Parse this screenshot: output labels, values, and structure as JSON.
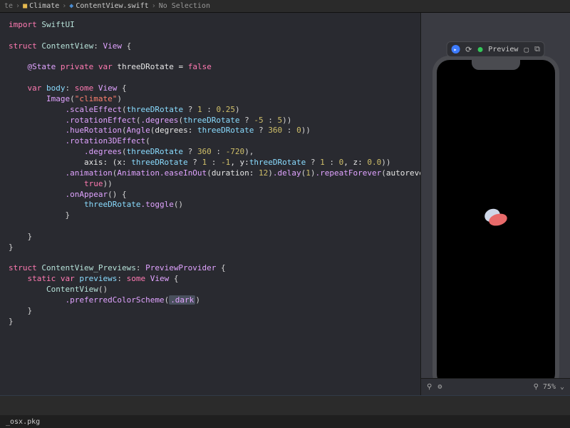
{
  "breadcrumb": {
    "project": "Climate",
    "file": "ContentView.swift",
    "selection": "No Selection"
  },
  "preview": {
    "label": "Preview",
    "zoom": "75%"
  },
  "download": {
    "filename": "_osx.pkg"
  },
  "code": {
    "import_kw": "import",
    "swiftui": "SwiftUI",
    "struct_kw": "struct",
    "contentview": "ContentView",
    "view": "View",
    "state": "@State",
    "private": "private",
    "var_kw": "var",
    "threeDRotate": "threeDRotate",
    "eq_false": " = ",
    "false_lit": "false",
    "body": "body",
    "some": "some",
    "image": "Image",
    "climate_str": "\"climate\"",
    "scaleEffect": ".scaleEffect",
    "rotationEffect": ".rotationEffect",
    "degrees": ".degrees",
    "hueRotation": ".hueRotation",
    "angle": "Angle",
    "degrees_lbl": "degrees:",
    "rotation3DEffect": ".rotation3DEffect",
    "axis_lbl": "axis: (x: ",
    "y_lbl": ", y:",
    "z_lbl": ", z: ",
    "animation": ".animation",
    "animation_type": "Animation",
    "easeInOut": ".easeInOut",
    "duration_lbl": "duration:",
    "delay": ".delay",
    "repeatForever": ".repeatForever",
    "autoreverses": "autoreverses:",
    "true_lit": "true",
    "onAppear": ".onAppear",
    "toggle": ".toggle",
    "previews_struct": "ContentView_Previews",
    "previewprovider": "PreviewProvider",
    "static": "static",
    "previews": "previews",
    "preferredColorScheme": ".preferredColorScheme",
    "dark": ".dark",
    "n1": "1",
    "n025": "0.25",
    "nm5": "-5",
    "n5": "5",
    "n360": "360",
    "n0": "0",
    "nm720": "-720",
    "nm1": "-1",
    "n00": "0.0",
    "n12": "12"
  }
}
